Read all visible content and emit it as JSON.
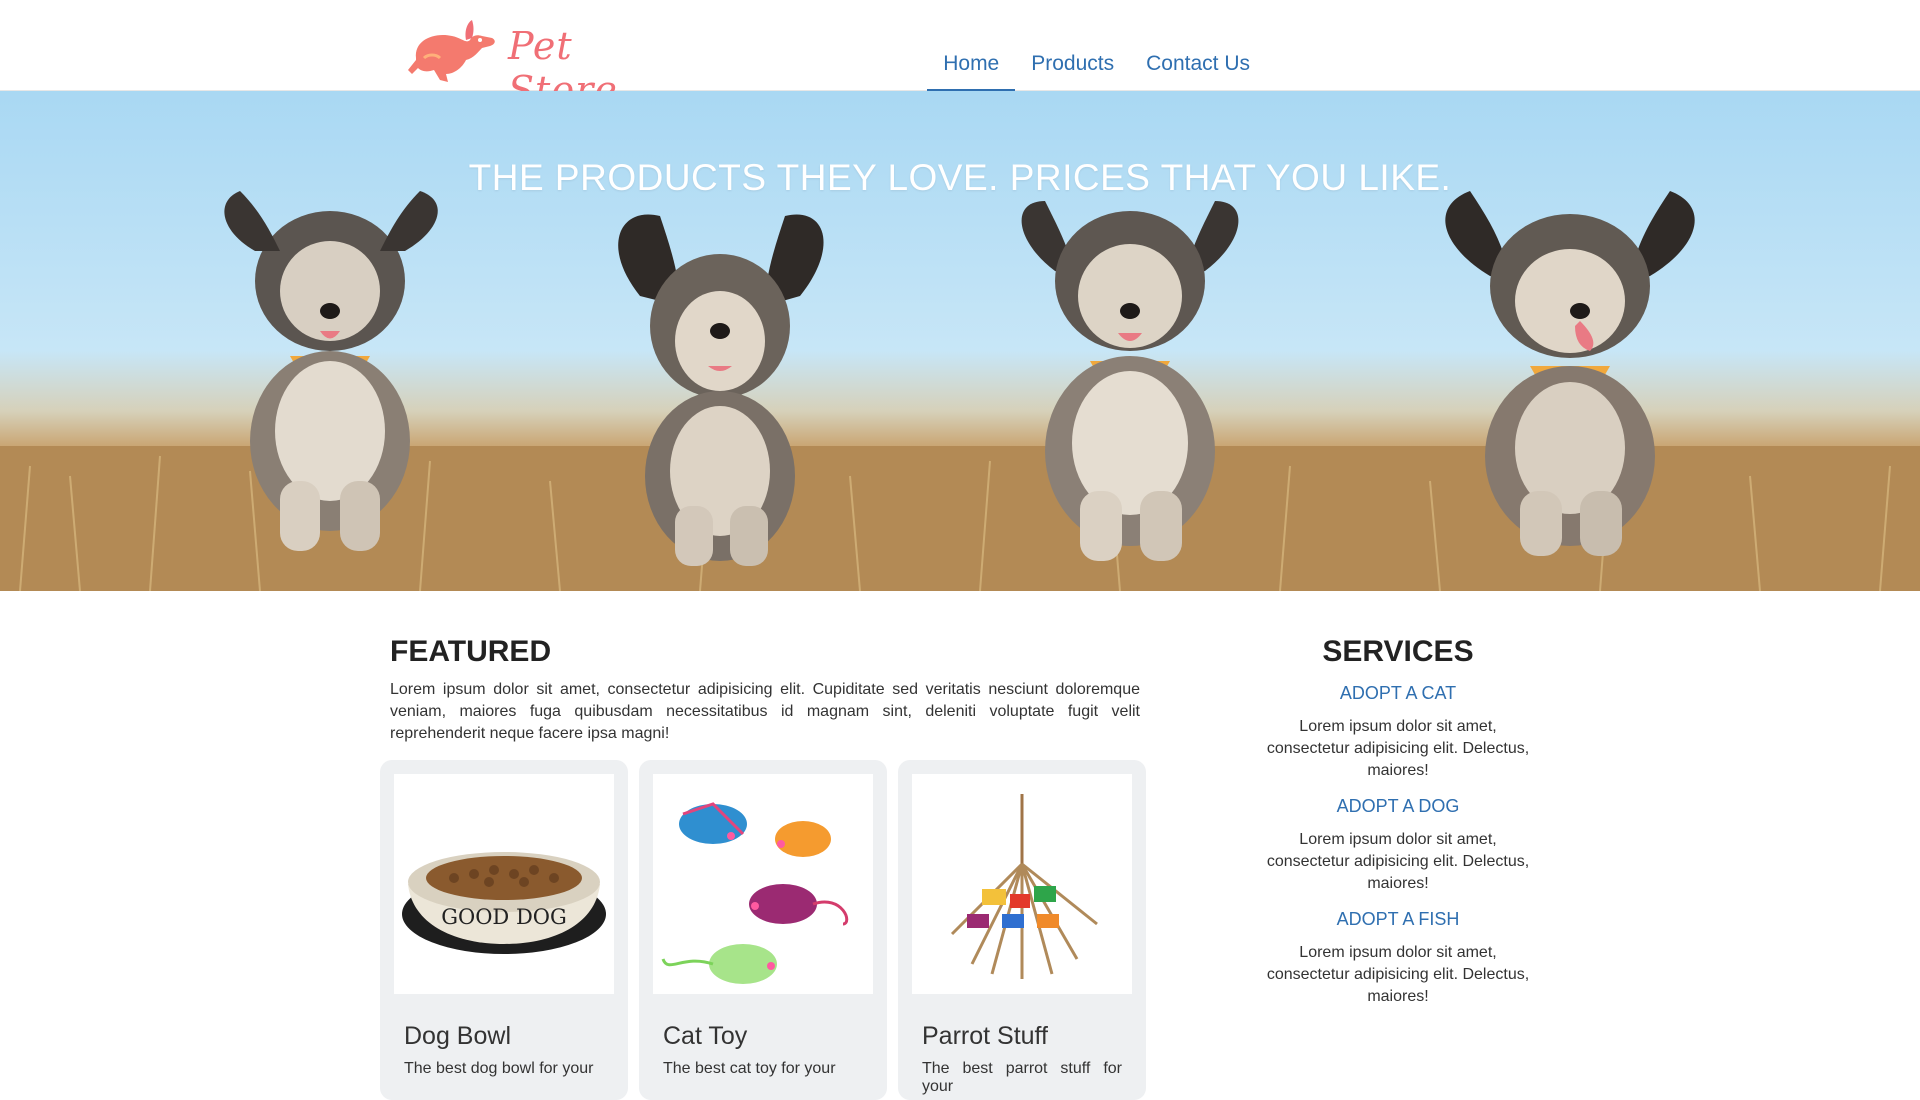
{
  "brand": {
    "name": "Pet Store",
    "logo_icon": "running-dog-icon",
    "color": "#f06f76"
  },
  "nav": [
    {
      "label": "Home",
      "active": true
    },
    {
      "label": "Products",
      "active": false
    },
    {
      "label": "Contact Us",
      "active": false
    }
  ],
  "hero": {
    "headline": "THE PRODUCTS THEY LOVE. PRICES THAT YOU LIKE."
  },
  "featured": {
    "title": "FEATURED",
    "description": "Lorem ipsum dolor sit amet, consectetur adipisicing elit. Cupiditate sed veritatis nesciunt doloremque veniam, maiores fuga quibusdam necessitatibus id magnam sint, deleniti voluptate fugit velit reprehenderit neque facere ipsa magni!",
    "cards": [
      {
        "title": "Dog Bowl",
        "text": "The best dog bowl for your",
        "image": "dog-bowl-image",
        "bowl_text": "GOOD DOG"
      },
      {
        "title": "Cat Toy",
        "text": "The best cat toy for your",
        "image": "cat-toy-mice-image"
      },
      {
        "title": "Parrot Stuff",
        "text": "The best parrot stuff for your",
        "image": "parrot-toy-image"
      }
    ]
  },
  "services": {
    "title": "SERVICES",
    "items": [
      {
        "label": "ADOPT A CAT",
        "text": "Lorem ipsum dolor sit amet, consectetur adipisicing elit. Delectus, maiores!"
      },
      {
        "label": "ADOPT A DOG",
        "text": "Lorem ipsum dolor sit amet, consectetur adipisicing elit. Delectus, maiores!"
      },
      {
        "label": "ADOPT A FISH",
        "text": "Lorem ipsum dolor sit amet, consectetur adipisicing elit. Delectus, maiores!"
      }
    ]
  },
  "colors": {
    "link": "#2f6fb0",
    "card_bg": "#eef0f2"
  }
}
